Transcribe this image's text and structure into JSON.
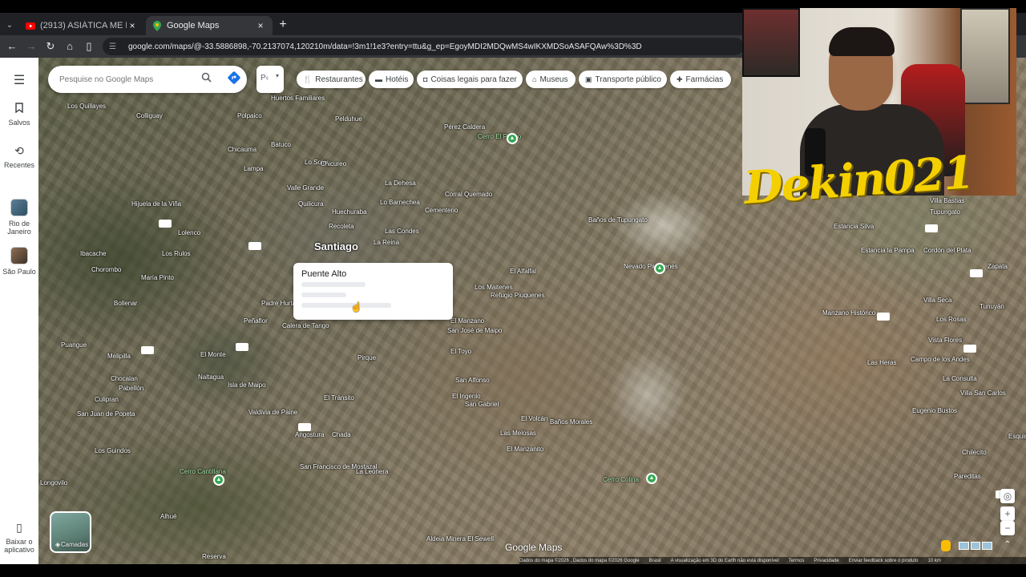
{
  "browser": {
    "tabs": [
      {
        "title": "(2913) ASIÁTICA ME LEVOU AO",
        "favicon": "youtube-icon",
        "active": false
      },
      {
        "title": "Google Maps",
        "favicon": "maps-pin-icon",
        "active": true
      }
    ],
    "url": "google.com/maps/@-33.5886898,-70.2137074,120210m/data=!3m1!1e3?entry=ttu&g_ep=EgoyMDI2MDQwMS4wIKXMDSoASAFQAw%3D%3D"
  },
  "sidebar": {
    "items": [
      {
        "label": "Salvos",
        "icon": "bookmark-icon"
      },
      {
        "label": "Recentes",
        "icon": "history-icon"
      },
      {
        "label": "Rio de Janeiro",
        "icon": "place-thumbnail"
      },
      {
        "label": "São Paulo",
        "icon": "place-thumbnail"
      }
    ],
    "app_label": "Baixar o aplicativo"
  },
  "search": {
    "placeholder": "Pesquise no Google Maps",
    "value": ""
  },
  "chips": [
    {
      "label": "Restaurantes",
      "icon": "fork-knife-icon"
    },
    {
      "label": "Hotéis",
      "icon": "bed-icon"
    },
    {
      "label": "Coisas legais para fazer",
      "icon": "camera-icon"
    },
    {
      "label": "Museus",
      "icon": "museum-icon"
    },
    {
      "label": "Transporte público",
      "icon": "bus-icon"
    },
    {
      "label": "Farmácias",
      "icon": "pharmacy-icon"
    }
  ],
  "popup": {
    "title": "Puente Alto"
  },
  "map_labels": {
    "santiago": "Santiago",
    "places": [
      "Los Quillayes",
      "Colliguay",
      "Polpaico",
      "Huertos Familiares",
      "Pelduhue",
      "Pérez Caldera",
      "Cerro El Plomo",
      "Chicauma",
      "Batuco",
      "Lo Solar",
      "Chicureo",
      "Lampa",
      "Valle Grande",
      "La Dehesa",
      "Quilicura",
      "Huechuraba",
      "Lo Barnechea",
      "Corral Quemado",
      "Cementerio",
      "Hijuela de la Viña",
      "Recoleta",
      "Las Condes",
      "La Reina",
      "Lolenco",
      "Los Rulos",
      "Ibacache",
      "Chorombo",
      "María Pinto",
      "El Alfalfal",
      "Los Maitenes",
      "Refugio Piuquenes",
      "Nevado Piuquenes",
      "Bollenar",
      "Padre Hurtado",
      "Peñaflor",
      "Calera de Tango",
      "El Manzano",
      "San José de Maipo",
      "El Toyo",
      "Puangue",
      "Melipilla",
      "El Monte",
      "Pirque",
      "San Alfonso",
      "Naltagua",
      "Isla de Maipo",
      "El Tránsito",
      "Chocalan",
      "Pabellón",
      "Culipran",
      "San Juan de Popeta",
      "El Ingenio",
      "San Gabriel",
      "Valdivia de Paine",
      "El Volcán",
      "Baños Morales",
      "Las Melosas",
      "Angostura",
      "Chada",
      "El Manzanito",
      "Los Guindos",
      "Cerro Cantillana",
      "San Francisco de Mostazal",
      "La Leonera",
      "Cerro Colina",
      "Alhué",
      "Reserva",
      "Aldeia Minera El Sewell",
      "Longovilo",
      "Baños de Tupungato",
      "Estancia Silva",
      "Villa Bastias",
      "Tupungato",
      "Estancia la Pampa",
      "Cordón del Plata",
      "Zapata",
      "Tunuyán",
      "Villa Seca",
      "Los Rosas",
      "Manzano Histórico",
      "Vista Flores",
      "Las Heras",
      "Campo de los Andes",
      "La Consulta",
      "Villa San Carlos",
      "Eugenio Bustos",
      "Chilecito",
      "Pareditas",
      "Esquina"
    ]
  },
  "map_branding": "Google Maps",
  "layers_label": "Camadas",
  "attribution": [
    "Dados do mapa ©2026 , Dados do mapa ©2026 Google",
    "Brasil",
    "A visualização em 3D do Earth não está disponível",
    "Termos",
    "Privacidade",
    "Enviar feedback sobre o produto",
    "10 km"
  ],
  "streamer_name": "Dekin021"
}
